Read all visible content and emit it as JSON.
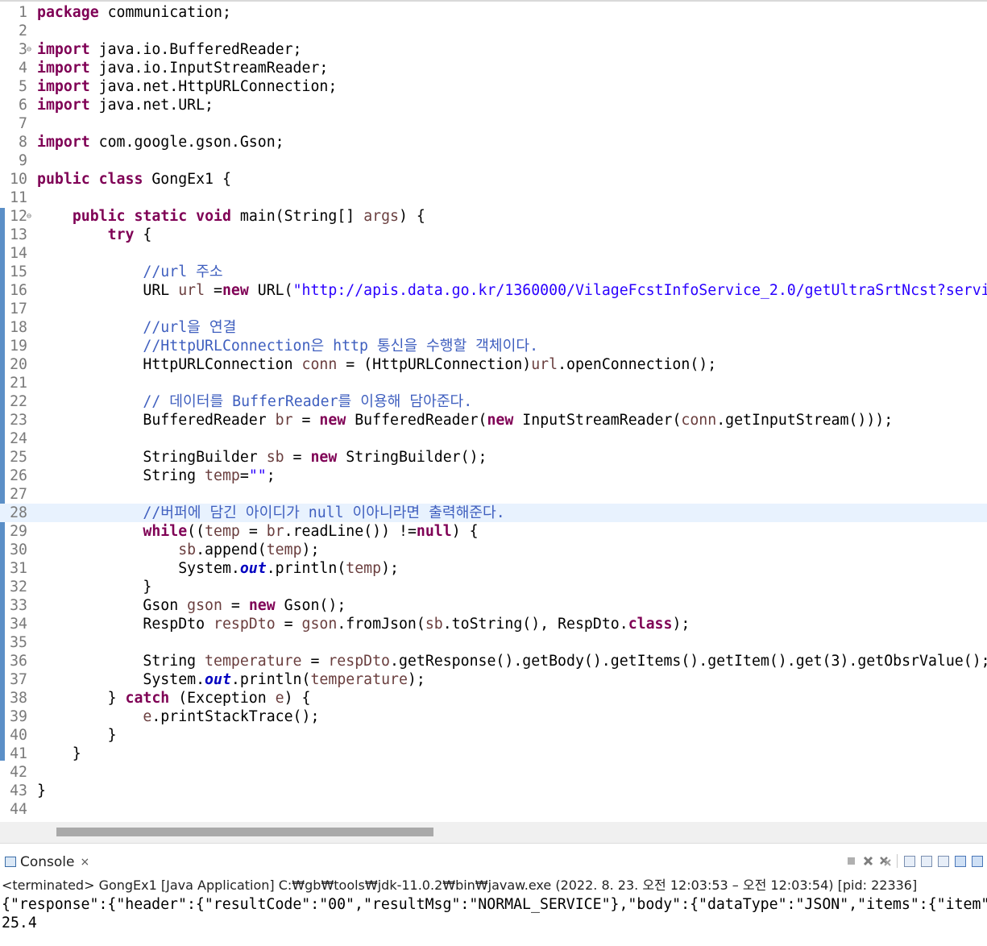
{
  "editor": {
    "lines": [
      {
        "n": "1",
        "html": "<span class='kw'>package</span> communication;"
      },
      {
        "n": "2",
        "html": ""
      },
      {
        "n": "3",
        "fold": true,
        "html": "<span class='kw'>import</span> java.io.BufferedReader;"
      },
      {
        "n": "4",
        "html": "<span class='kw'>import</span> java.io.InputStreamReader;"
      },
      {
        "n": "5",
        "html": "<span class='kw'>import</span> java.net.HttpURLConnection;"
      },
      {
        "n": "6",
        "html": "<span class='kw'>import</span> java.net.URL;"
      },
      {
        "n": "7",
        "html": ""
      },
      {
        "n": "8",
        "html": "<span class='kw'>import</span> com.google.gson.Gson;"
      },
      {
        "n": "9",
        "html": ""
      },
      {
        "n": "10",
        "html": "<span class='kw'>public</span> <span class='kw'>class</span> GongEx1 {"
      },
      {
        "n": "11",
        "html": ""
      },
      {
        "n": "12",
        "fold": true,
        "html": "    <span class='kw'>public</span> <span class='kw'>static</span> <span class='kw'>void</span> main(String[] <span class='var'>args</span>) {"
      },
      {
        "n": "13",
        "html": "        <span class='kw'>try</span> {"
      },
      {
        "n": "14",
        "html": ""
      },
      {
        "n": "15",
        "html": "            <span class='cm'>//url 주소</span>"
      },
      {
        "n": "16",
        "html": "            URL <span class='var'>url</span> =<span class='kw'>new</span> URL(<span class='st'>\"http://apis.data.go.kr/1360000/VilageFcstInfoService_2.0/getUltraSrtNcst?serviceKey</span>"
      },
      {
        "n": "17",
        "html": ""
      },
      {
        "n": "18",
        "html": "            <span class='cm'>//url을 연결</span>"
      },
      {
        "n": "19",
        "html": "            <span class='cm'>//HttpURLConnection은 http 통신을 수행할 객체이다.</span>"
      },
      {
        "n": "20",
        "html": "            HttpURLConnection <span class='var'>conn</span> = (HttpURLConnection)<span class='var'>url</span>.openConnection();"
      },
      {
        "n": "21",
        "html": ""
      },
      {
        "n": "22",
        "html": "            <span class='cm'>// 데이터를 BufferReader를 이용해 담아준다.</span>"
      },
      {
        "n": "23",
        "html": "            BufferedReader <span class='var'>br</span> = <span class='kw'>new</span> BufferedReader(<span class='kw'>new</span> InputStreamReader(<span class='var'>conn</span>.getInputStream()));"
      },
      {
        "n": "24",
        "html": ""
      },
      {
        "n": "25",
        "html": "            StringBuilder <span class='var'>sb</span> = <span class='kw'>new</span> StringBuilder();"
      },
      {
        "n": "26",
        "html": "            String <span class='var'>temp</span>=<span class='st'>\"\"</span>;"
      },
      {
        "n": "27",
        "html": ""
      },
      {
        "n": "28",
        "current": true,
        "html": "            <span class='cm'>//버퍼에 담긴 아이디가 null 이아니라면 출력해준다.</span>"
      },
      {
        "n": "29",
        "html": "            <span class='kw'>while</span>((<span class='var'>temp</span> = <span class='var'>br</span>.readLine()) !=<span class='kw'>null</span>) {"
      },
      {
        "n": "30",
        "html": "                <span class='var'>sb</span>.append(<span class='var'>temp</span>);"
      },
      {
        "n": "31",
        "html": "                System.<span class='fld'>out</span>.println(<span class='var'>temp</span>);"
      },
      {
        "n": "32",
        "html": "            }"
      },
      {
        "n": "33",
        "html": "            Gson <span class='var'>gson</span> = <span class='kw'>new</span> Gson();"
      },
      {
        "n": "34",
        "html": "            RespDto <span class='var'>respDto</span> = <span class='var'>gson</span>.fromJson(<span class='var'>sb</span>.toString(), RespDto.<span class='kw'>class</span>);"
      },
      {
        "n": "35",
        "html": ""
      },
      {
        "n": "36",
        "html": "            String <span class='var'>temperature</span> = <span class='var'>respDto</span>.getResponse().getBody().getItems().getItem().get(3).getObsrValue();"
      },
      {
        "n": "37",
        "html": "            System.<span class='fld'>out</span>.println(<span class='var'>temperature</span>);"
      },
      {
        "n": "38",
        "html": "        } <span class='kw'>catch</span> (Exception <span class='var'>e</span>) {"
      },
      {
        "n": "39",
        "html": "            <span class='var'>e</span>.printStackTrace();"
      },
      {
        "n": "40",
        "html": "        }"
      },
      {
        "n": "41",
        "html": "    }"
      },
      {
        "n": "42",
        "html": ""
      },
      {
        "n": "43",
        "html": "}"
      },
      {
        "n": "44",
        "html": ""
      }
    ]
  },
  "console": {
    "tab_label": "Console",
    "close_glyph": "×",
    "status": "<terminated> GongEx1 [Java Application] C:₩gb₩tools₩jdk-11.0.2₩bin₩javaw.exe  (2022. 8. 23. 오전 12:03:53 – 오전 12:03:54) [pid: 22336]",
    "output": [
      "{\"response\":{\"header\":{\"resultCode\":\"00\",\"resultMsg\":\"NORMAL_SERVICE\"},\"body\":{\"dataType\":\"JSON\",\"items\":{\"item\":[{\"baseDate",
      "25.4"
    ]
  },
  "icons": [
    "console-icon",
    "terminate-icon",
    "remove-launch-icon",
    "remove-all-icon",
    "scroll-lock-icon",
    "word-wrap-icon",
    "pin-console-icon",
    "display-selected-console-icon",
    "open-console-icon"
  ]
}
